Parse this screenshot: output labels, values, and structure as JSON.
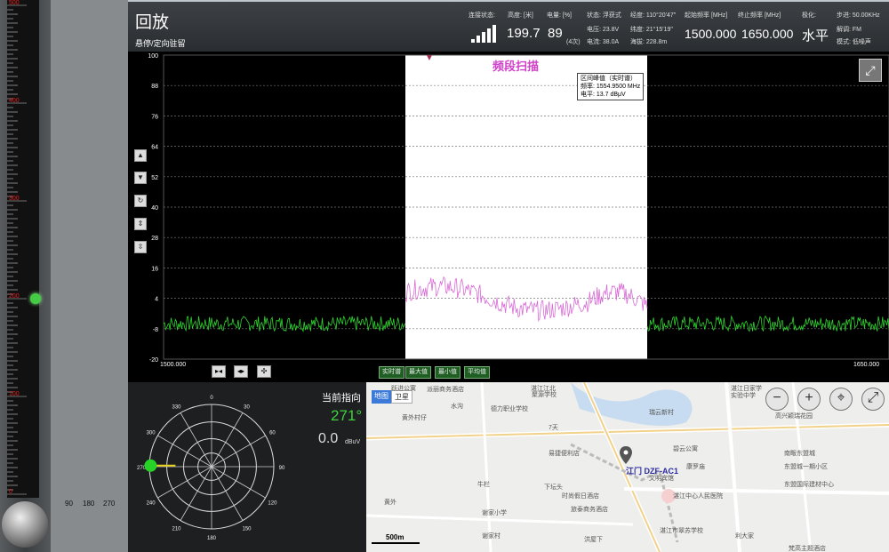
{
  "header": {
    "title": "回放",
    "subtitle": "悬停/定向驻留",
    "conn_label": "连接状态:",
    "height_label": "高度: [米]",
    "battery_label": "电量: [%]",
    "height_value": "199.7",
    "battery_value": "89",
    "battery_sub": "(4次)",
    "status": "状态: 浮获式",
    "voltage": "电压: 23.8V",
    "current": "电流: 38.0A",
    "longitude": "经度: 110°20'47\"",
    "latitude": "纬度: 21°15'19\"",
    "altitude": "海拔: 228.8m",
    "start_freq_label": "起始频率 [MHz]",
    "stop_freq_label": "终止频率 [MHz]",
    "polar_label": "极化:",
    "start_freq": "1500.000",
    "stop_freq": "1650.000",
    "polarization": "水平",
    "step_label": "步进: 50.00KHz",
    "demod_label": "解调: FM",
    "mode_label": "模式: 低噪声"
  },
  "spectrum": {
    "title": "频段扫描",
    "y_ticks": [
      "100",
      "88",
      "76",
      "64",
      "52",
      "40",
      "28",
      "16",
      "4",
      "-8",
      "-20"
    ],
    "x_start": "1500.000",
    "x_end": "1650.000",
    "tooltip_title": "区间峰值（实时谱）",
    "tooltip_freq": "频率: 1554.9500 MHz",
    "tooltip_level": "电平: 13.7 dBμV",
    "buttons": [
      "实时谱",
      "最大值",
      "最小值",
      "平均值"
    ]
  },
  "polar": {
    "direction_label": "当前指向",
    "direction_value": "271°",
    "level_value": "0.0",
    "level_unit": "dBuV",
    "angles": [
      "0",
      "30",
      "60",
      "90",
      "120",
      "150",
      "180",
      "210",
      "240",
      "270",
      "300",
      "330"
    ]
  },
  "ruler": {
    "labels": [
      "500",
      "400",
      "300",
      "200",
      "100",
      "0"
    ],
    "degree_labels": [
      "90",
      "180",
      "270"
    ]
  },
  "map": {
    "tab_map": "地图",
    "tab_satellite": "卫星",
    "marker_label": "江门 DZF-AC1",
    "scale": "500m",
    "labels": [
      "跃进公寓",
      "派丽商务酒店",
      "湛江江北",
      "聚源学校",
      "湛江日家学",
      "实验中学",
      "高兴颖瑞花园",
      "水沟",
      "德力职业学校",
      "瑞云新村",
      "黄外村仔",
      "7天",
      "碧云公寓",
      "南畈东盟城",
      "易捷便利店",
      "康罗庙",
      "东盟城一期小区",
      "牛栏",
      "文明宾馆",
      "下坛头",
      "时尚假日酒店",
      "湛江中心人民医院",
      "东盟国际建材中心",
      "黄外",
      "旅泰商务酒店",
      "谢家小学",
      "湛江市翠苏学校",
      "利大家",
      "谢家村",
      "洪屋下",
      "梵高主题酒店"
    ]
  },
  "chart_data": {
    "type": "line",
    "title": "频段扫描",
    "x": [
      1500,
      1650
    ],
    "xlim": [
      1500,
      1650
    ],
    "ylim": [
      -20,
      100
    ],
    "yticks": [
      100,
      88,
      76,
      64,
      52,
      40,
      28,
      16,
      4,
      -8,
      -20
    ],
    "xlabel": "",
    "ylabel": "",
    "highlight_band": [
      1550,
      1600
    ],
    "series": [
      {
        "values_desc": "noise floor around -6 dBμV outside band, elevated signal up to 13.7 dBμV within 1550–1600 MHz"
      }
    ],
    "peak": {
      "freq": 1554.95,
      "level": 13.7
    }
  }
}
